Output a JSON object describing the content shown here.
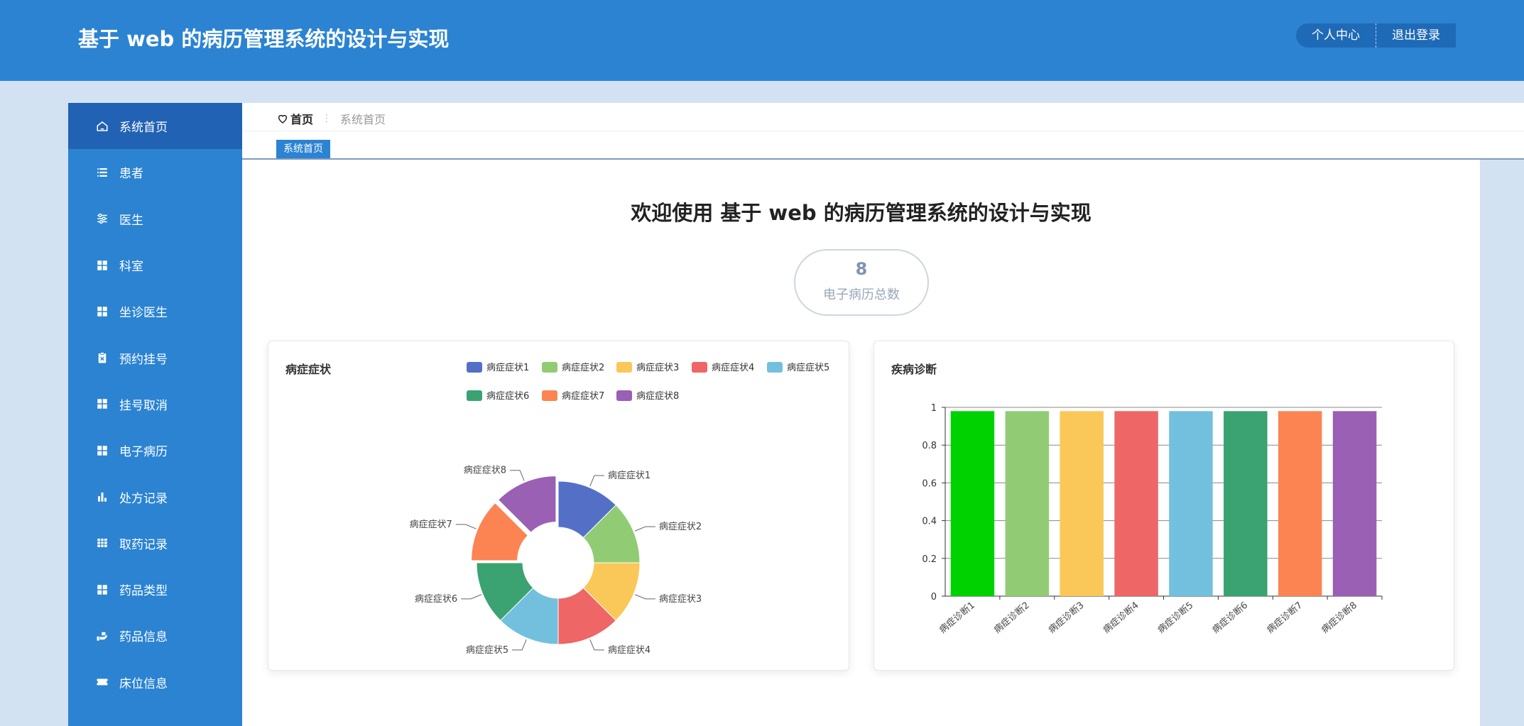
{
  "header": {
    "title": "基于 web 的病历管理系统的设计与实现",
    "profile_label": "个人中心",
    "logout_label": "退出登录"
  },
  "sidebar": {
    "items": [
      {
        "label": "系统首页",
        "icon": "home-icon",
        "active": true
      },
      {
        "label": "患者",
        "icon": "list-icon"
      },
      {
        "label": "医生",
        "icon": "sliders-icon"
      },
      {
        "label": "科室",
        "icon": "grid-icon"
      },
      {
        "label": "坐诊医生",
        "icon": "grid-icon"
      },
      {
        "label": "预约挂号",
        "icon": "clipboard-icon"
      },
      {
        "label": "挂号取消",
        "icon": "grid-icon"
      },
      {
        "label": "电子病历",
        "icon": "grid-icon"
      },
      {
        "label": "处方记录",
        "icon": "bar-chart-icon"
      },
      {
        "label": "取药记录",
        "icon": "table-icon"
      },
      {
        "label": "药品类型",
        "icon": "grid-icon"
      },
      {
        "label": "药品信息",
        "icon": "hand-icon"
      },
      {
        "label": "床位信息",
        "icon": "ticket-icon"
      }
    ]
  },
  "breadcrumb": {
    "home": "首页",
    "separator": "⋮",
    "current": "系统首页"
  },
  "tabs": [
    {
      "label": "系统首页"
    }
  ],
  "welcome": "欢迎使用 基于 web 的病历管理系统的设计与实现",
  "stat": {
    "value": "8",
    "label": "电子病历总数"
  },
  "chart_data": [
    {
      "type": "pie",
      "variant": "rose-donut",
      "title": "病症症状",
      "legend_position": "top-right",
      "categories": [
        "病症症状1",
        "病症症状2",
        "病症症状3",
        "病症症状4",
        "病症症状5",
        "病症症状6",
        "病症症状7",
        "病症症状8"
      ],
      "values": [
        1,
        1,
        1,
        1,
        1,
        1,
        1,
        1
      ],
      "colors": [
        "#5470c6",
        "#91cc75",
        "#fac858",
        "#ee6666",
        "#73c0de",
        "#3ba272",
        "#fc8452",
        "#9a60b4"
      ]
    },
    {
      "type": "bar",
      "title": "疾病诊断",
      "categories": [
        "病症诊断1",
        "病症诊断2",
        "病症诊断3",
        "病症诊断4",
        "病症诊断5",
        "病症诊断6",
        "病症诊断7",
        "病症诊断8"
      ],
      "values": [
        1,
        1,
        1,
        1,
        1,
        1,
        1,
        1
      ],
      "ylim": [
        0,
        1
      ],
      "yticks": [
        "0",
        "0.2",
        "0.4",
        "0.6",
        "0.8",
        "1"
      ],
      "grid": true,
      "colors": [
        "#00d200",
        "#91cc75",
        "#fac858",
        "#ee6666",
        "#73c0de",
        "#3ba272",
        "#fc8452",
        "#9a60b4"
      ]
    }
  ]
}
